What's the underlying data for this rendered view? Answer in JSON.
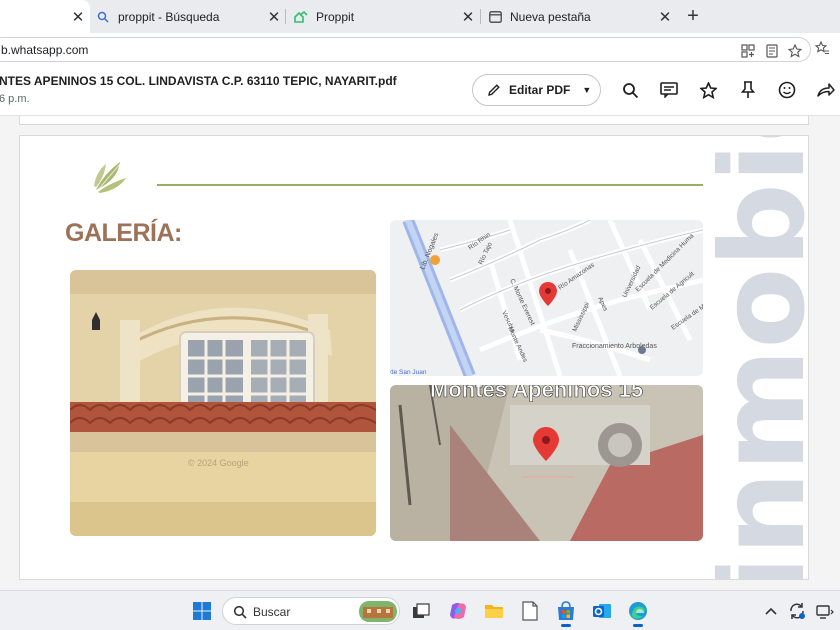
{
  "browser": {
    "tabs": [
      {
        "title": "",
        "active": true,
        "icon": "whatsapp-icon"
      },
      {
        "title": "proppit - Búsqueda",
        "active": false,
        "icon": "search-icon"
      },
      {
        "title": "Proppit",
        "active": false,
        "icon": "proppit-icon"
      },
      {
        "title": "Nueva pestaña",
        "active": false,
        "icon": "newtab-icon"
      }
    ],
    "new_tab_label": "+",
    "close_label": "✕",
    "url": "b.whatsapp.com"
  },
  "pdf": {
    "title": "NTES APENINOS 15 COL. LINDAVISTA C.P. 63110 TEPIC, NAYARIT.pdf",
    "subtitle": "6 p.m.",
    "edit_label": "Editar PDF"
  },
  "document": {
    "heading": "GALERÍA:",
    "map_labels": {
      "street_1": "Lib. Nogales",
      "street_2": "Río Rhin",
      "street_3": "Río Tajo",
      "street_4": "Río Amazonas",
      "street_5": "C. Monte Everest",
      "street_6": "Vesubio",
      "street_7": "Monte Andes",
      "street_8": "Mississippi",
      "street_9": "Apes",
      "street_10": "Universidad",
      "street_11": "Escuela de Medicina Huma",
      "street_12": "Escuela de Agricult",
      "street_13": "Escuela de Medicina",
      "neighborhood": "Fraccionamiento Arboledas",
      "corner": "de San Juan"
    },
    "sat_label": "Montes Apeninos 15",
    "watermark": "© 2024 Google",
    "side_text": "inmobie"
  },
  "taskbar": {
    "search_label": "Buscar",
    "apps": [
      "start-icon",
      "task-view-icon",
      "copilot-icon",
      "file-explorer-icon",
      "notepad-icon",
      "microsoft-store-icon",
      "outlook-icon",
      "edge-icon"
    ],
    "tray": [
      "chevron-up-icon",
      "sync-icon",
      "network-icon"
    ]
  },
  "colors": {
    "accent": "#9c7258",
    "line": "#9aac6a",
    "side_text": "#d5d9e1"
  }
}
